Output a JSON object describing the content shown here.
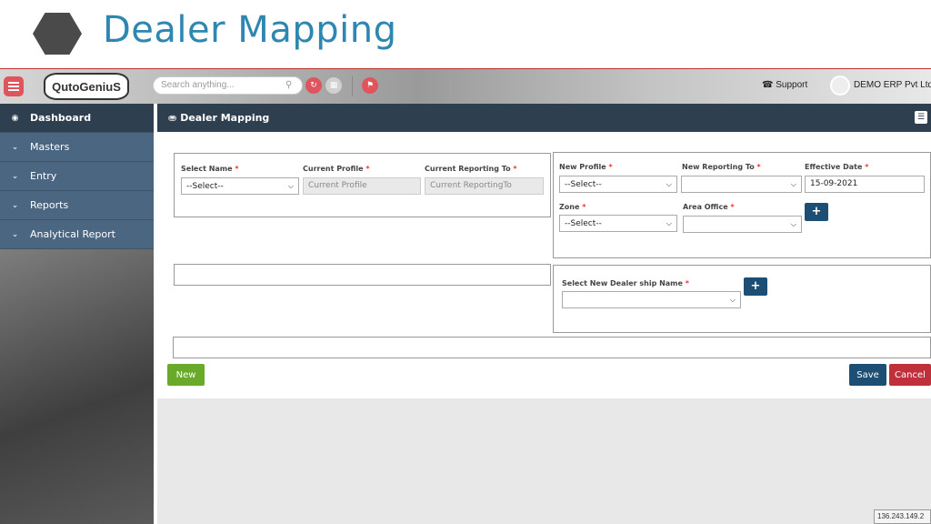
{
  "slide": {
    "title": "Dealer Mapping"
  },
  "topbar": {
    "logo_text": "QutoGeniuS",
    "search_placeholder": "Search anything...",
    "support_label": "Support",
    "company_name": "DEMO ERP Pvt Ltd"
  },
  "sidebar": {
    "items": [
      {
        "label": "Dashboard",
        "icon": "dashboard-icon",
        "active": true
      },
      {
        "label": "Masters",
        "icon": "chevron-down-icon"
      },
      {
        "label": "Entry",
        "icon": "chevron-down-icon"
      },
      {
        "label": "Reports",
        "icon": "chevron-down-icon"
      },
      {
        "label": "Analytical Report",
        "icon": "chevron-down-icon"
      }
    ]
  },
  "panel": {
    "title": "Dealer Mapping",
    "left": {
      "select_name_label": "Select Name",
      "select_name_value": "--Select--",
      "current_profile_label": "Current Profile",
      "current_profile_placeholder": "Current Profile",
      "current_reporting_label": "Current Reporting To",
      "current_reporting_placeholder": "Current ReportingTo"
    },
    "right": {
      "new_profile_label": "New Profile",
      "new_profile_value": "--Select--",
      "new_reporting_label": "New Reporting To",
      "new_reporting_value": "",
      "effective_date_label": "Effective Date",
      "effective_date_value": "15-09-2021",
      "zone_label": "Zone",
      "zone_value": "--Select--",
      "area_office_label": "Area Office",
      "area_office_value": ""
    },
    "dealer": {
      "label": "Select New Dealer ship Name",
      "value": ""
    },
    "required_mark": "*",
    "plus_symbol": "+",
    "buttons": {
      "new": "New",
      "save": "Save",
      "cancel": "Cancel"
    }
  },
  "colors": {
    "accent": "#2e87b0",
    "header": "#2e3f4f",
    "nav": "#4b6680",
    "new_btn": "#6aaa2a",
    "save_btn": "#1d4e73",
    "cancel_btn": "#c0303a"
  },
  "footer": {
    "ip": "136.243.149.2"
  }
}
